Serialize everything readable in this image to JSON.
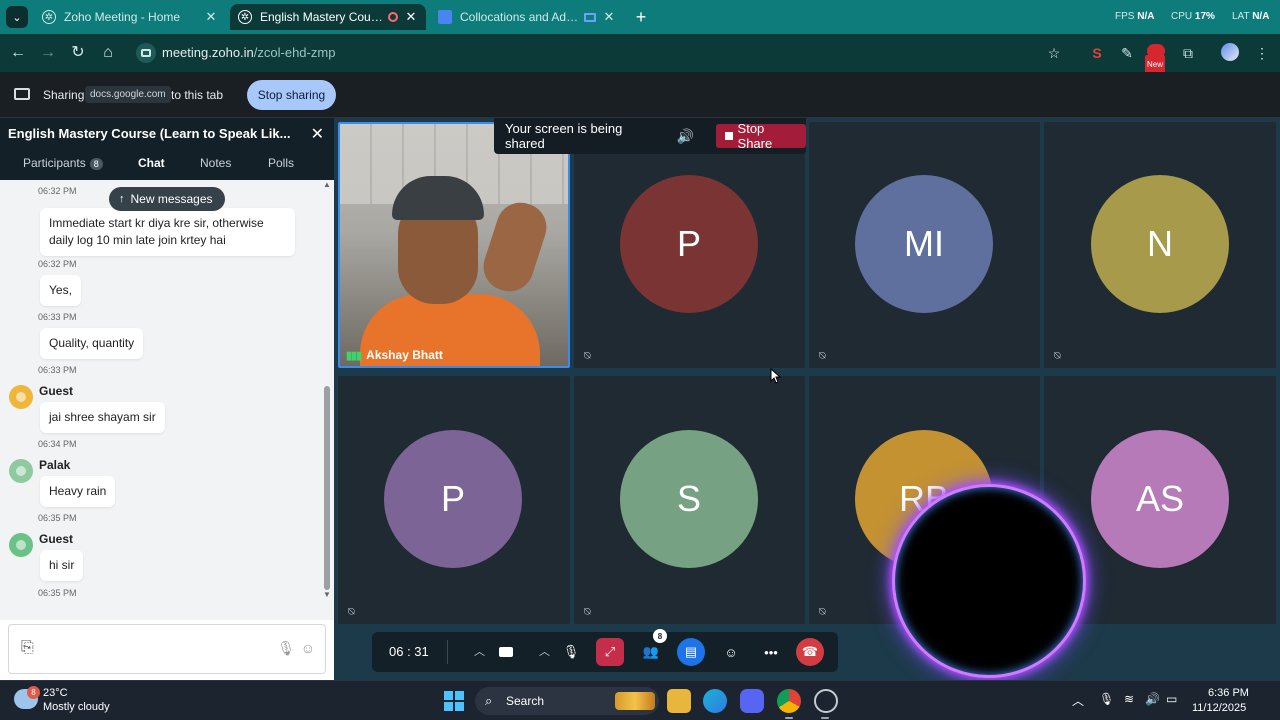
{
  "browser": {
    "tabs": [
      {
        "label": "Zoho Meeting - Home"
      },
      {
        "label": "English Mastery Course (Lea"
      },
      {
        "label": "Collocations and Adjective"
      }
    ],
    "perf": {
      "fps_label": "FPS",
      "fps_value": "N/A",
      "cpu_label": "CPU",
      "cpu_value": "17%",
      "lat_label": "LAT",
      "lat_value": "N/A"
    },
    "url_domain": "meeting.zoho.in",
    "url_path": "/zcol-ehd-zmp",
    "ext_new_badge": "New"
  },
  "sharebar": {
    "sharing_label": "Sharing",
    "domain": "docs.google.com",
    "to_tab": "to this tab",
    "stop_button": "Stop sharing"
  },
  "chat_panel": {
    "meeting_title": "English Mastery Course (Learn to Speak Lik...",
    "tabs": [
      {
        "label": "Participants",
        "badge": "8"
      },
      {
        "label": "Chat"
      },
      {
        "label": "Notes"
      },
      {
        "label": "Polls"
      }
    ],
    "new_messages": "New messages",
    "messages": [
      {
        "time": "06:32 PM",
        "text_line1": "Immediate start kr diya kre sir, otherwise",
        "text_line2": "daily log 10 min late join krtey hai"
      },
      {
        "time": "06:32 PM",
        "text": "Yes,"
      },
      {
        "time": "06:33 PM",
        "text": "Quality, quantity"
      },
      {
        "time": "06:33 PM",
        "sender": "Guest",
        "text": "jai shree shayam sir",
        "avatar_color": "#f0b63c"
      },
      {
        "time": "06:34 PM",
        "sender": "Palak",
        "text": "Heavy rain",
        "avatar_color": "#8fc9a0"
      },
      {
        "time": "06:35 PM",
        "sender": "Guest",
        "text": "hi sir",
        "avatar_color": "#6cc286"
      },
      {
        "time": "06:35 PM"
      }
    ]
  },
  "video": {
    "share_banner": "Your screen is being shared",
    "stop_share": "Stop Share",
    "presenter_name": "Akshay Bhatt",
    "participants": [
      {
        "initials": "P",
        "color": "#7a3433"
      },
      {
        "initials": "MI",
        "color": "#5f6f9e"
      },
      {
        "initials": "N",
        "color": "#a79a4a"
      },
      {
        "initials": "P",
        "color": "#7d6496"
      },
      {
        "initials": "S",
        "color": "#76a283"
      },
      {
        "initials": "RB",
        "color": "#c49231"
      },
      {
        "initials": "AS",
        "color": "#b77ab8"
      }
    ]
  },
  "controls": {
    "timer": "06 : 31",
    "participants_badge": "8"
  },
  "taskbar": {
    "weather_badge": "8",
    "temperature": "23°C",
    "weather": "Mostly cloudy",
    "search_label": "Search",
    "time": "6:36 PM",
    "date": "11/12/2025"
  }
}
